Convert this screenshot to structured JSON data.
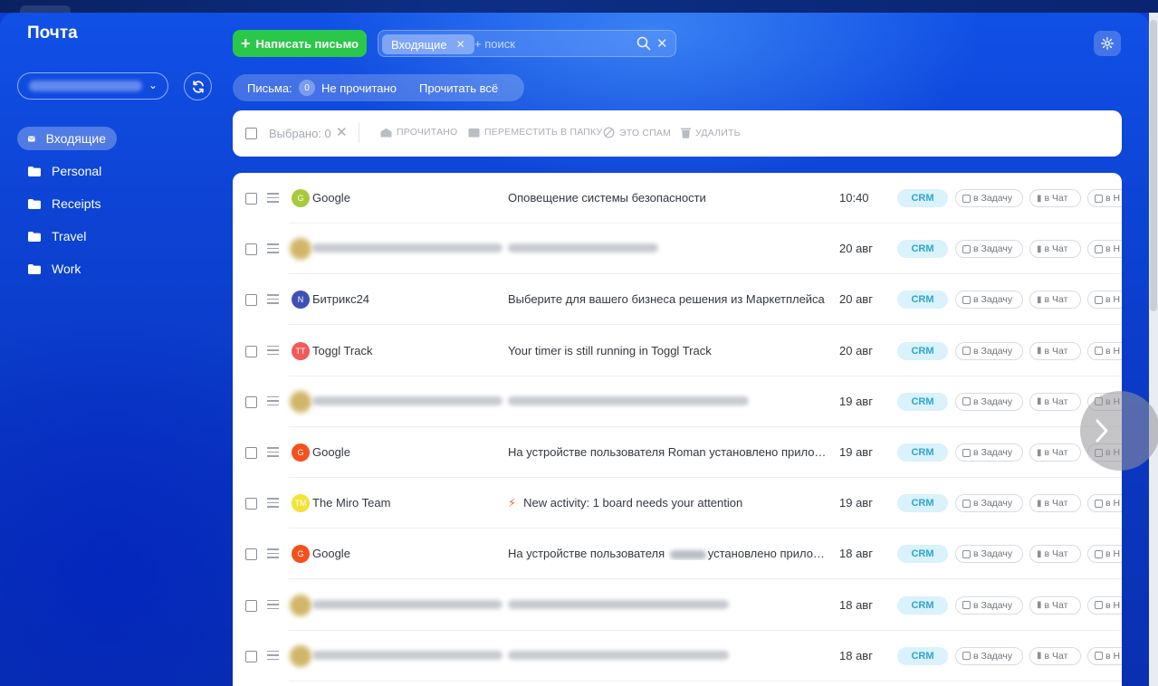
{
  "app": {
    "title": "Почта"
  },
  "sidebar": {
    "folders": [
      {
        "label": "Входящие",
        "active": true,
        "icon": "envelope-icon"
      },
      {
        "label": "Personal",
        "icon": "folder-icon"
      },
      {
        "label": "Receipts",
        "icon": "folder-icon"
      },
      {
        "label": "Travel",
        "icon": "folder-icon"
      },
      {
        "label": "Work",
        "icon": "folder-icon"
      }
    ]
  },
  "header": {
    "compose_label": "Написать письмо",
    "search_chip": "Входящие",
    "search_placeholder": "+ поиск"
  },
  "filters": {
    "label": "Письма:",
    "unread_count": "0",
    "unread_label": "Не прочитано",
    "read_all": "Прочитать всё"
  },
  "toolbar": {
    "selected": "Выбрано: 0",
    "mark_read": "ПРОЧИТАНО",
    "move": "ПЕРЕМЕСТИТЬ В ПАПКУ",
    "spam": "ЭТО СПАМ",
    "delete": "УДАЛИТЬ"
  },
  "row_actions": {
    "crm": "CRM",
    "task": "в Задачу",
    "chat": "в Чат",
    "more": "в Н"
  },
  "colors": {
    "accent_green": "#2bc74a",
    "crm_bg": "#d9f2fb",
    "crm_text": "#2fa4d0",
    "sidebar_bg": "#0d43d4"
  },
  "messages": [
    {
      "sender": "Google",
      "avatar": "G",
      "avatar_color": "#a7c93b",
      "subject": "Оповещение системы безопасности",
      "date": "10:40"
    },
    {
      "sender": "",
      "blurred": true,
      "subject": "",
      "date": "20 авг"
    },
    {
      "sender": "Битрикс24",
      "avatar": "N",
      "avatar_color": "#3f51b5",
      "subject": "Выберите для вашего бизнеса решения из Маркетплейса",
      "date": "20 авг"
    },
    {
      "sender": "Toggl Track",
      "avatar": "TT",
      "avatar_color": "#f15a59",
      "subject": "Your timer is still running in Toggl Track",
      "date": "20 авг"
    },
    {
      "sender": "",
      "blurred": true,
      "subject": "",
      "date": "19 авг"
    },
    {
      "sender": "Google",
      "avatar": "G",
      "avatar_color": "#f4511e",
      "subject": "На устройстве пользователя Roman установлено приложе...",
      "date": "19 авг"
    },
    {
      "sender": "The Miro Team",
      "avatar": "TM",
      "avatar_color": "#f5e237",
      "subject": "New activity: 1 board needs your attention",
      "date": "19 авг",
      "lightning": true
    },
    {
      "sender": "Google",
      "avatar": "G",
      "avatar_color": "#f4511e",
      "subject_pre": "На устройстве пользователя",
      "subject_post": "установлено приложе...",
      "date": "18 авг"
    },
    {
      "sender": "",
      "blurred": true,
      "subject": "",
      "date": "18 авг"
    },
    {
      "sender": "",
      "blurred": true,
      "subject": "",
      "date": "18 авг"
    }
  ]
}
